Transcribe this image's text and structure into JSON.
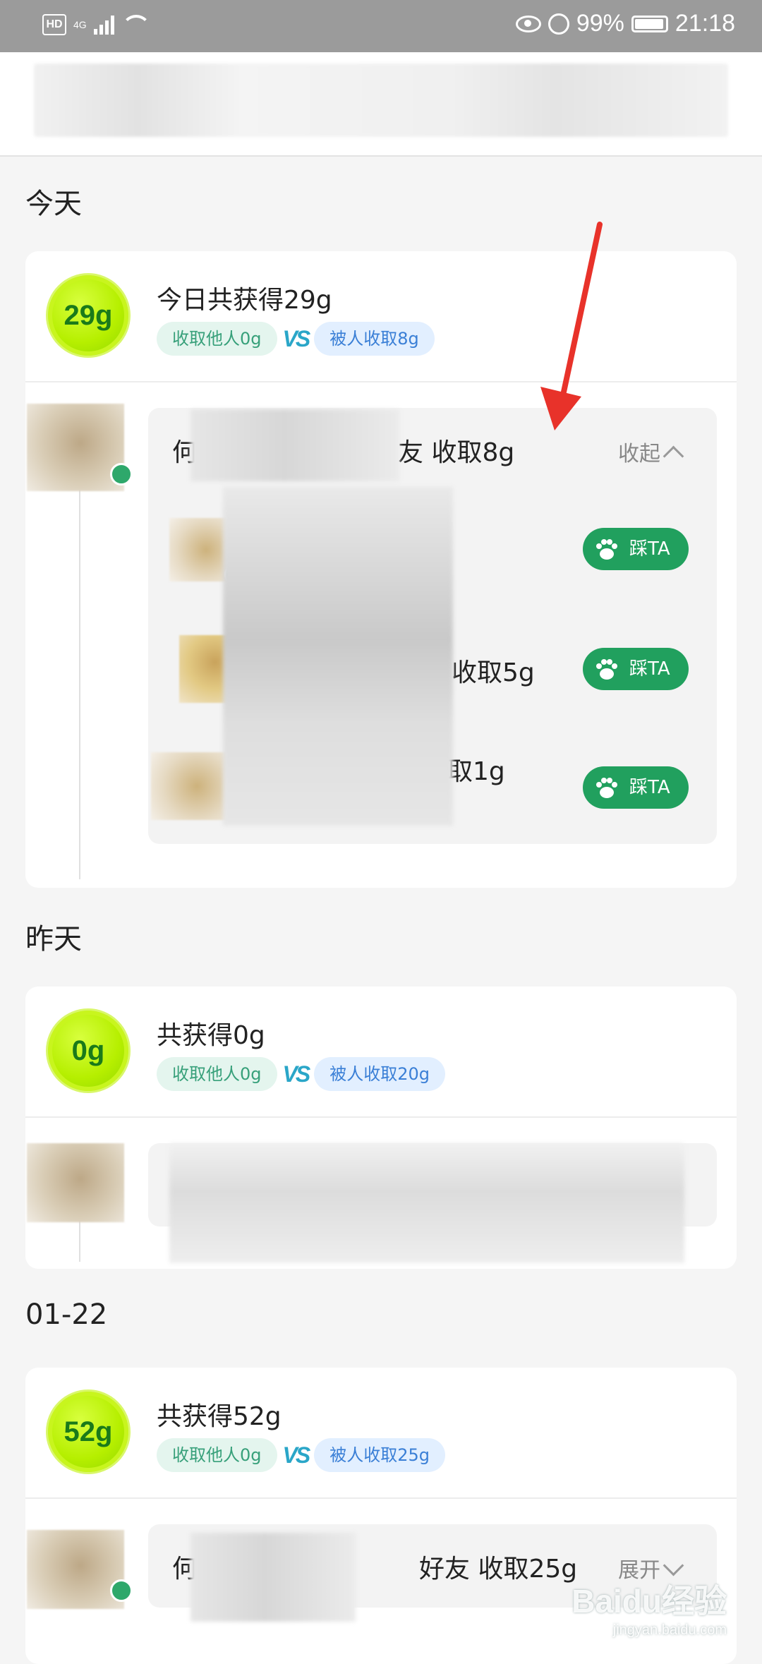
{
  "status_bar": {
    "hd": "HD",
    "network": "4G",
    "battery": "99%",
    "time": "21:18"
  },
  "sections": [
    {
      "label": "今天",
      "ball": "29g",
      "title": "今日共获得29g",
      "collect_others": "收取他人0g",
      "vs": "VS",
      "collected_by": "被人收取8g",
      "bubble_prefix": "何",
      "bubble_suffix": "友 收取8g",
      "toggle": "收起",
      "rows": [
        {
          "text": "",
          "button": "踩TA"
        },
        {
          "text": "收取5g",
          "button": "踩TA"
        },
        {
          "text": "取1g",
          "button": "踩TA"
        }
      ]
    },
    {
      "label": "昨天",
      "ball": "0g",
      "title": "共获得0g",
      "collect_others": "收取他人0g",
      "vs": "VS",
      "collected_by": "被人收取20g"
    },
    {
      "label": "01-22",
      "ball": "52g",
      "title": "共获得52g",
      "collect_others": "收取他人0g",
      "vs": "VS",
      "collected_by": "被人收取25g",
      "bubble_prefix": "何",
      "bubble_suffix": "好友 收取25g",
      "toggle": "展开"
    }
  ],
  "watermark": {
    "brand": "Baidu经验",
    "site": "jingyan.baidu.com"
  },
  "colors": {
    "accent_green": "#21a05e",
    "ball_green": "#b6ef00",
    "arrow": "#e8322a"
  }
}
